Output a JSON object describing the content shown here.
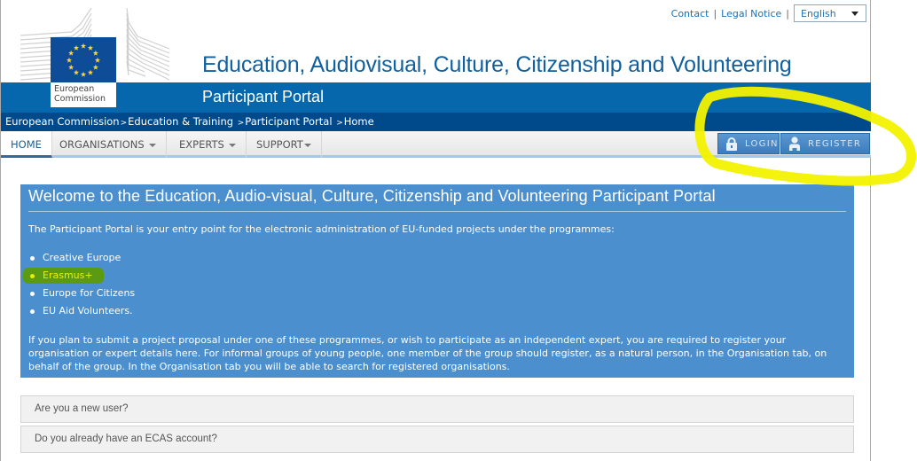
{
  "top_links": {
    "contact": "Contact",
    "legal": "Legal Notice",
    "separator": "|",
    "language": "English"
  },
  "logo": {
    "line1": "European",
    "line2": "Commission"
  },
  "header": {
    "title": "Education, Audiovisual, Culture, Citizenship and Volunteering",
    "subtitle": "Participant Portal"
  },
  "breadcrumb": {
    "items": [
      "European Commission",
      "Education & Training",
      "Participant Portal",
      "Home"
    ],
    "separator": ">"
  },
  "nav": {
    "items": [
      {
        "label": "HOME",
        "active": true
      },
      {
        "label": "ORGANISATIONS",
        "dropdown": true
      },
      {
        "label": "EXPERTS",
        "dropdown": true
      },
      {
        "label": "SUPPORT",
        "dropdown": true
      }
    ],
    "login": "LOGIN",
    "register": "REGISTER"
  },
  "welcome": {
    "title": "Welcome to the Education, Audio-visual, Culture, Citizenship and Volunteering Participant Portal",
    "intro": "The Participant Portal is your entry point for the electronic administration of EU-funded projects under the programmes:",
    "programmes": [
      "Creative Europe",
      "Erasmus+",
      "Europe for Citizens",
      "EU Aid Volunteers."
    ],
    "highlighted_programme": "Erasmus+",
    "outro": "If you plan to submit a project proposal under one of these programmes, or wish to participate as an independent expert, you are required to register your organisation or expert details here. For informal groups of young people, one member of the group should register, as a natural person, in the Organisation tab, on behalf of the group. In the Organisation tab you will be able to search for registered organisations."
  },
  "accordion": [
    {
      "label": "Are you a new user?"
    },
    {
      "label": "Do you already have an ECAS account?"
    }
  ],
  "colors": {
    "brand_blue": "#0767ad",
    "breadcrumb_blue": "#004a8c",
    "welcome_bg": "#4b8fcf",
    "annotation_yellow": "#f5f500",
    "highlight_green": "#5c9a12"
  }
}
